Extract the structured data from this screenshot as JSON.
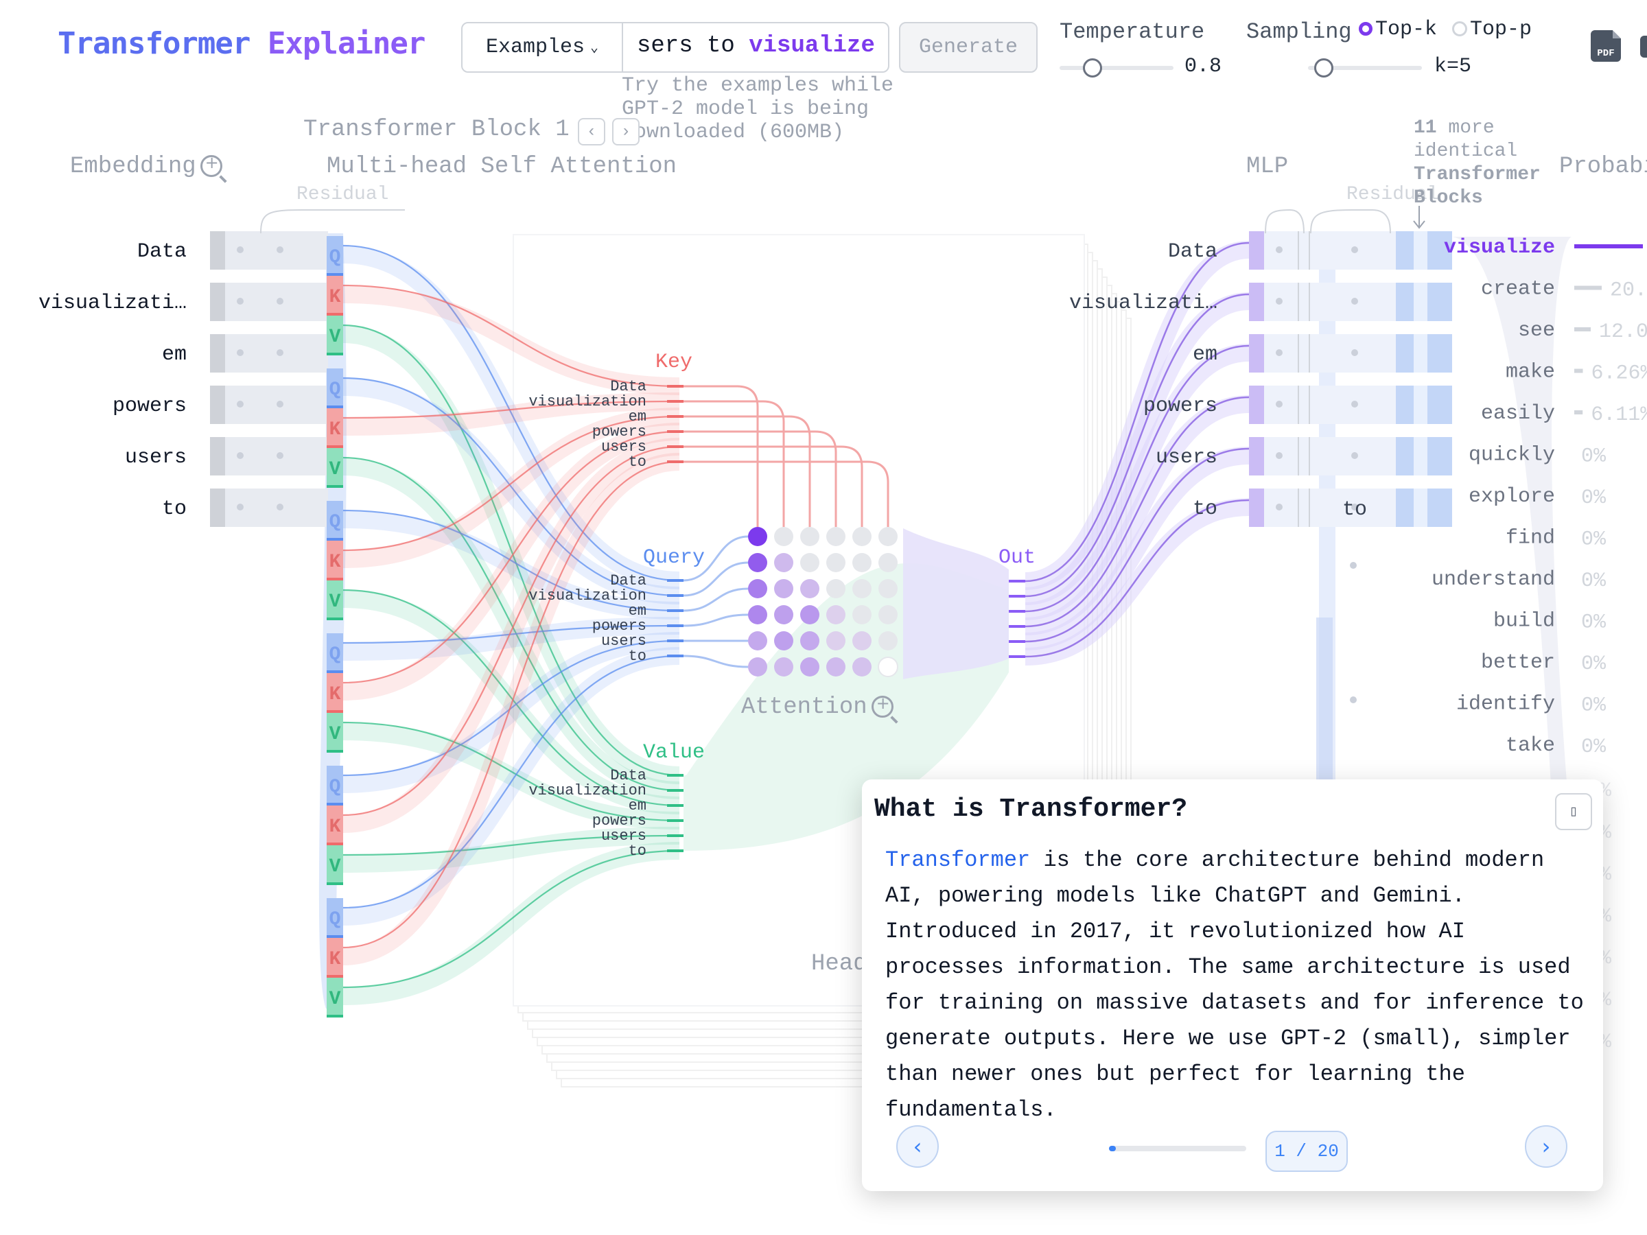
{
  "header": {
    "logo_part1": "Transformer",
    "logo_part2": "Explainer",
    "examples_label": "Examples",
    "prompt_prefix": "sers to ",
    "prompt_predicted": "visualize",
    "generate_label": "Generate",
    "hint": "Try the examples while GPT-2 model is being downloaded (600MB)",
    "temperature_label": "Temperature",
    "temperature_value": "0.8",
    "temperature_level": 0.27,
    "sampling_label": "Sampling",
    "topk_label": "Top-k",
    "topp_label": "Top-p",
    "k_value": "k=5",
    "k_level": 0.12,
    "pdf_icon_text": "PDF"
  },
  "sections": {
    "transformer_block": "Transformer Block 1",
    "embedding": "Embedding",
    "attention": "Multi-head Self Attention",
    "residual": "Residual",
    "mlp": "MLP",
    "more_blocks_count": "11",
    "more_blocks_text": "more identical",
    "more_blocks_bold": "Transformer Blocks",
    "probabilities": "Probabi",
    "key": "Key",
    "query": "Query",
    "value": "Value",
    "out": "Out",
    "attention_label": "Attention",
    "head": "Head"
  },
  "tokens": [
    "Data",
    "visualizati…",
    "em",
    "powers",
    "users",
    "to"
  ],
  "head_tokens": [
    "Data",
    "visualization",
    "em",
    "powers",
    "users",
    "to"
  ],
  "qkv": [
    "Q",
    "K",
    "V"
  ],
  "last_token": "to",
  "candidates": [
    {
      "word": "visualize",
      "pct": ""
    },
    {
      "word": "create",
      "pct": "20."
    },
    {
      "word": "see",
      "pct": "12.0"
    },
    {
      "word": "make",
      "pct": "6.26%"
    },
    {
      "word": "easily",
      "pct": "6.11%"
    },
    {
      "word": "quickly",
      "pct": "0%"
    },
    {
      "word": "explore",
      "pct": "0%"
    },
    {
      "word": "find",
      "pct": "0%"
    },
    {
      "word": "understand",
      "pct": "0%"
    },
    {
      "word": "build",
      "pct": "0%"
    },
    {
      "word": "better",
      "pct": "0%"
    },
    {
      "word": "identify",
      "pct": "0%"
    },
    {
      "word": "take",
      "pct": "0%"
    }
  ],
  "candidate_probs": [
    0.5,
    0.2,
    0.12,
    0.0626,
    0.0611,
    0,
    0,
    0,
    0,
    0,
    0,
    0,
    0
  ],
  "faded_pcts": [
    "%",
    "%",
    "%",
    "%",
    "%",
    "%",
    "%"
  ],
  "attention_matrix": [
    [
      1.0,
      0,
      0,
      0,
      0,
      0
    ],
    [
      0.8,
      0.25,
      0,
      0,
      0,
      0
    ],
    [
      0.6,
      0.3,
      0.25,
      0,
      0,
      0
    ],
    [
      0.55,
      0.4,
      0.45,
      0.1,
      0,
      0
    ],
    [
      0.35,
      0.4,
      0.35,
      0.1,
      0.08,
      0
    ],
    [
      0.3,
      0.25,
      0.35,
      0.25,
      0.2,
      0.05
    ]
  ],
  "modal": {
    "title": "What is Transformer?",
    "close_icon": "close-icon",
    "link_word": "Transformer",
    "body": " is the core architecture behind modern AI, powering models like ChatGPT and Gemini. Introduced in 2017, it revolutionized how AI processes information. The same architecture is used for training on massive datasets and for inference to generate outputs. Here we use GPT-2 (small), simpler than newer ones but perfect for learning the fundamentals.",
    "page": "1 / 20",
    "progress": 0.05,
    "prev": "‹",
    "next": "›"
  },
  "colors": {
    "query": "#5b8def",
    "key": "#ef6b6b",
    "value": "#2fbf86",
    "accent": "#7c3aed",
    "logo_blue": "#5b6ef0",
    "logo_purple": "#8b5cf6"
  }
}
